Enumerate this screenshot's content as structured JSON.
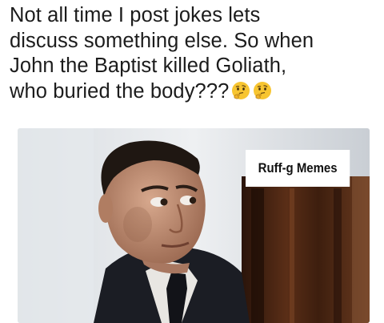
{
  "post": {
    "lines": [
      "Not all time I post jokes lets",
      "discuss something else. So when",
      "John the Baptist killed Goliath,",
      "who buried the body???"
    ],
    "emojis": [
      "thinking-face-icon",
      "thinking-face-icon"
    ]
  },
  "meme": {
    "watermark": "Ruff-g Memes"
  }
}
